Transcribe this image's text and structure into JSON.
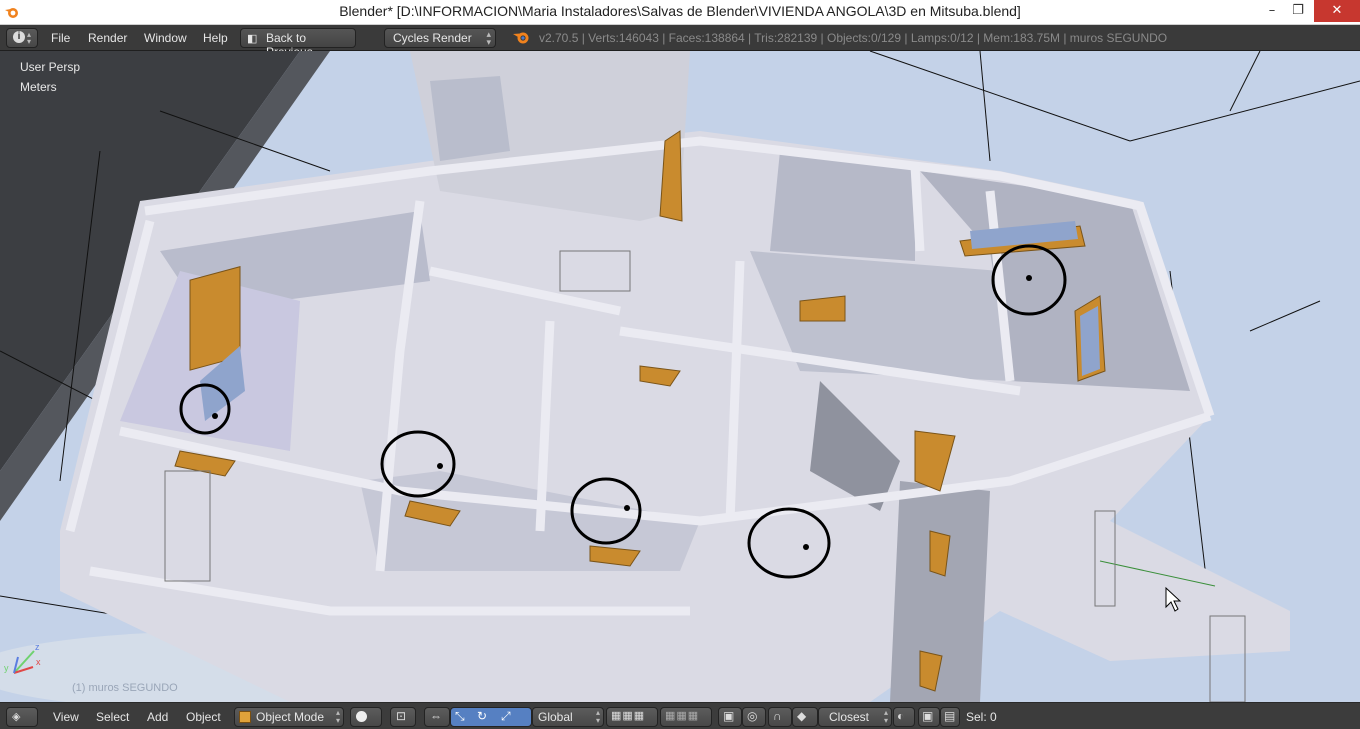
{
  "window": {
    "title": "Blender* [D:\\INFORMACION\\Maria Instaladores\\Salvas de Blender\\VIVIENDA ANGOLA\\3D en Mitsuba.blend]",
    "minimize_glyph": "–",
    "maximize_glyph": "❐",
    "close_glyph": "✕"
  },
  "top_menu": {
    "editor_icon": "info-icon",
    "items": [
      "File",
      "Render",
      "Window",
      "Help"
    ],
    "back_label": "Back to Previous",
    "render_engine": "Cycles Render",
    "stats": "v2.70.5 | Verts:146043 | Faces:138864 | Tris:282139 | Objects:0/129 | Lamps:0/12 | Mem:183.75M | muros SEGUNDO"
  },
  "viewport": {
    "view_name": "User Persp",
    "units": "Meters",
    "object_label": "(1) muros SEGUNDO",
    "axis_x": "x",
    "axis_y": "y",
    "axis_z": "z",
    "colors": {
      "background": "#c4d2e8",
      "walls": "#d9d9e3",
      "annotation": "#000000",
      "window_frames": "#c98b2e"
    }
  },
  "bottom_bar": {
    "view_label": "View",
    "select_label": "Select",
    "add_label": "Add",
    "object_label": "Object",
    "mode_label": "Object Mode",
    "orientation_label": "Global",
    "snap_target_label": "Closest",
    "selection_count": "Sel: 0"
  }
}
